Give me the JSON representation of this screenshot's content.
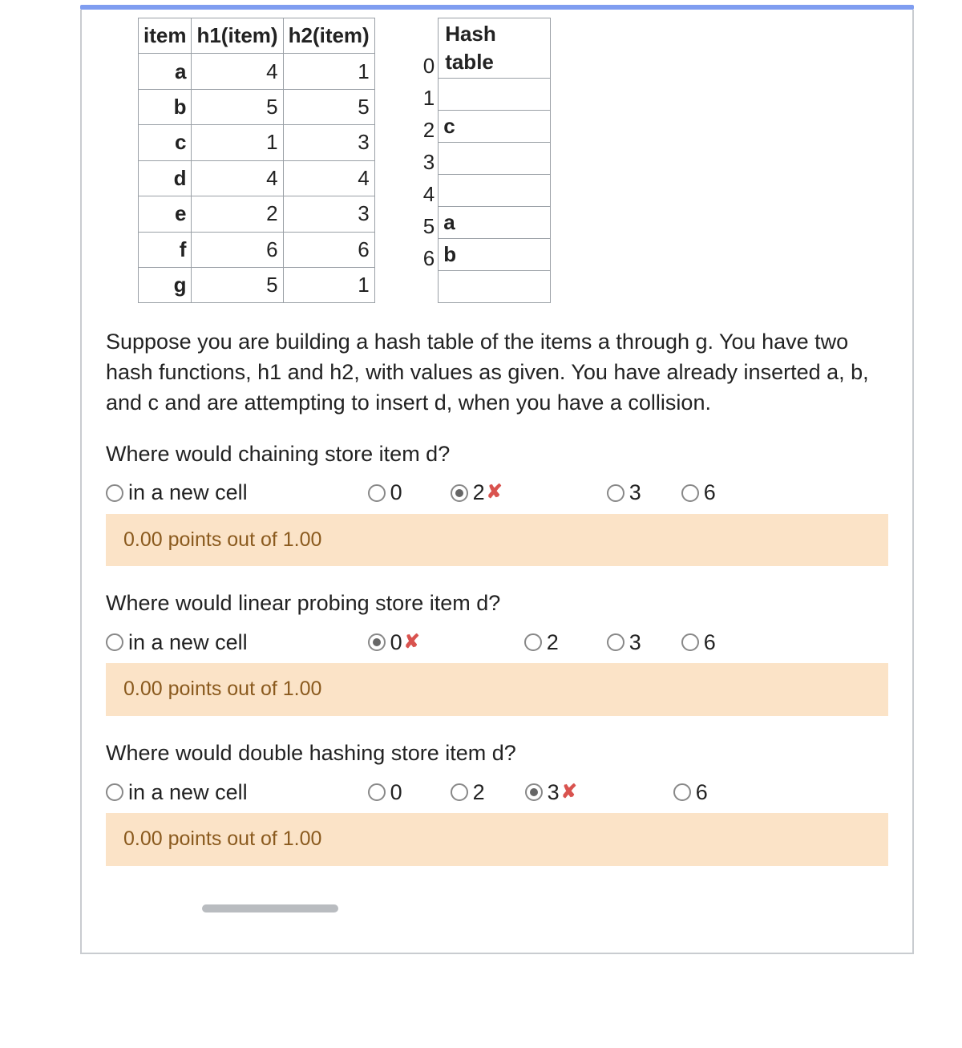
{
  "item_table": {
    "headers": [
      "item",
      "h1(item)",
      "h2(item)"
    ],
    "rows": [
      {
        "item": "a",
        "h1": "4",
        "h2": "1"
      },
      {
        "item": "b",
        "h1": "5",
        "h2": "5"
      },
      {
        "item": "c",
        "h1": "1",
        "h2": "3"
      },
      {
        "item": "d",
        "h1": "4",
        "h2": "4"
      },
      {
        "item": "e",
        "h1": "2",
        "h2": "3"
      },
      {
        "item": "f",
        "h1": "6",
        "h2": "6"
      },
      {
        "item": "g",
        "h1": "5",
        "h2": "1"
      }
    ]
  },
  "hash_table": {
    "header": "Hash table",
    "indices": [
      "0",
      "1",
      "2",
      "3",
      "4",
      "5",
      "6"
    ],
    "cells": [
      "",
      "c",
      "",
      "",
      "a",
      "b",
      ""
    ]
  },
  "prose": "Suppose you are building a hash table of the items a through g. You have two hash functions, h1 and h2, with values as given. You have already inserted a, b, and c and are attempting to insert d, when you have a collision.",
  "q1": {
    "text": "Where would chaining store item d?",
    "options": [
      "in a new cell",
      "0",
      "2",
      "3",
      "6"
    ],
    "selected_index": 2,
    "wrong_mark": "✘",
    "score": "0.00 points out of 1.00"
  },
  "q2": {
    "text": "Where would linear probing store item d?",
    "options": [
      "in a new cell",
      "0",
      "2",
      "3",
      "6"
    ],
    "selected_index": 1,
    "wrong_mark": "✘",
    "score": "0.00 points out of 1.00"
  },
  "q3": {
    "text": "Where would double hashing store item d?",
    "options": [
      "in a new cell",
      "0",
      "2",
      "3",
      "6"
    ],
    "selected_index": 3,
    "wrong_mark": "✘",
    "score": "0.00 points out of 1.00"
  }
}
